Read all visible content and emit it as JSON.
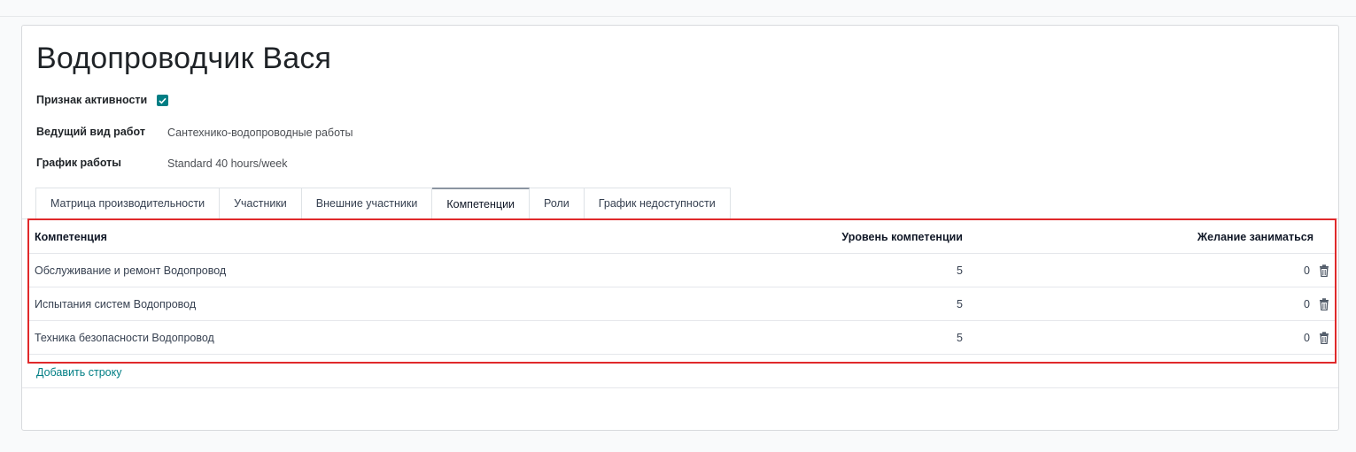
{
  "record": {
    "title": "Водопроводчик Вася"
  },
  "fields": {
    "active_label": "Признак активности",
    "active_checked": true,
    "work_type_label": "Ведущий вид работ",
    "work_type_value": "Сантехнико-водопроводные работы",
    "schedule_label": "График работы",
    "schedule_value": "Standard 40 hours/week"
  },
  "tabs": [
    {
      "label": "Матрица производительности",
      "active": false
    },
    {
      "label": "Участники",
      "active": false
    },
    {
      "label": "Внешние участники",
      "active": false
    },
    {
      "label": "Компетенции",
      "active": true
    },
    {
      "label": "Роли",
      "active": false
    },
    {
      "label": "График недоступности",
      "active": false
    }
  ],
  "table": {
    "columns": [
      "Компетенция",
      "Уровень компетенции",
      "Желание заниматься"
    ],
    "rows": [
      {
        "name": "Обслуживание и ремонт Водопровод",
        "level": "5",
        "wish": "0"
      },
      {
        "name": "Испытания систем Водопровод",
        "level": "5",
        "wish": "0"
      },
      {
        "name": "Техника безопасности Водопровод",
        "level": "5",
        "wish": "0"
      }
    ],
    "add_line": "Добавить строку"
  },
  "colors": {
    "accent": "#017e84",
    "highlight_border": "#e0292b"
  },
  "icons": {
    "checkbox": "check-icon",
    "row_delete": "trash-icon"
  }
}
